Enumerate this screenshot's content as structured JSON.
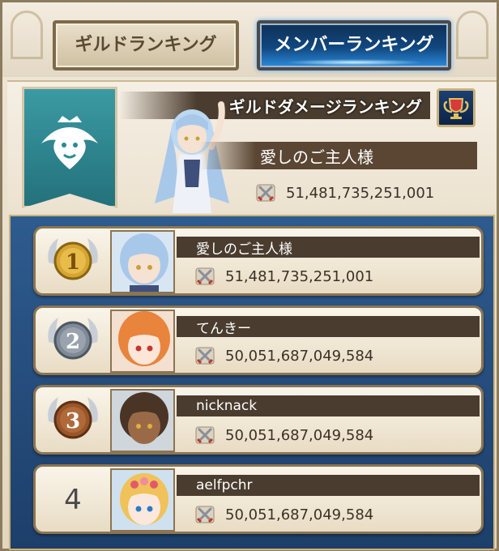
{
  "tabs": {
    "guild_ranking": "ギルドランキング",
    "member_ranking": "メンバーランキング"
  },
  "header": {
    "title": "ギルドダメージランキング",
    "guild_name": "愛しのご主人様",
    "score": "51,481,735,251,001"
  },
  "ranking": [
    {
      "rank": "1",
      "name": "愛しのご主人様",
      "score": "51,481,735,251,001",
      "medal": "gold",
      "portrait_hair": "#a8c8ea"
    },
    {
      "rank": "2",
      "name": "てんきー",
      "score": "50,051,687,049,584",
      "medal": "silver",
      "portrait_hair": "#e8843c"
    },
    {
      "rank": "3",
      "name": "nicknack",
      "score": "50,051,687,049,584",
      "medal": "bronze",
      "portrait_hair": "#4a3426"
    },
    {
      "rank": "4",
      "name": "aelfpchr",
      "score": "50,051,687,049,584",
      "medal": "none",
      "portrait_hair": "#f0c25a"
    }
  ],
  "colors": {
    "panel_blue": "#1d3f6a",
    "banner_teal": "#2a8a94",
    "name_bar": "#4a3c2e",
    "gold": "#d6a531",
    "silver": "#9aa3ad",
    "bronze": "#b06a3a"
  },
  "icons": {
    "crossed_swords": "crossed-swords-icon",
    "lion_crest": "lion-crest-icon",
    "trophy": "trophy-icon"
  }
}
